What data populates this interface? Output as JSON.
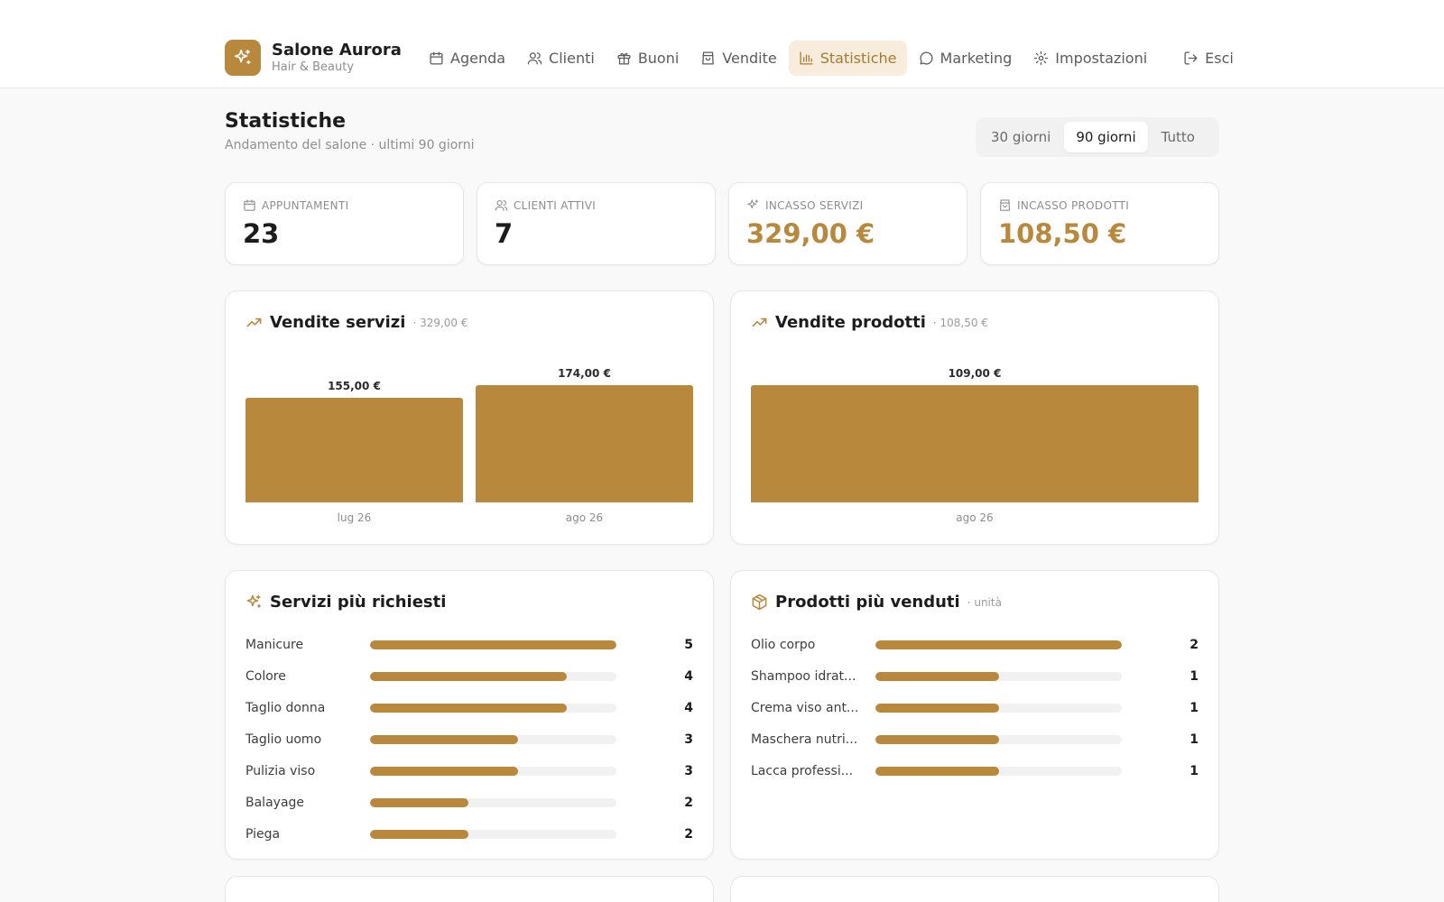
{
  "brand": {
    "name": "Salone Aurora",
    "subtitle": "Hair & Beauty",
    "accent": "#b8883c"
  },
  "nav": [
    {
      "label": "Agenda",
      "icon": "calendar-icon",
      "active": false
    },
    {
      "label": "Clienti",
      "icon": "users-icon",
      "active": false
    },
    {
      "label": "Buoni",
      "icon": "gift-icon",
      "active": false
    },
    {
      "label": "Vendite",
      "icon": "shopping-bag-icon",
      "active": false
    },
    {
      "label": "Statistiche",
      "icon": "bar-chart-icon",
      "active": true
    },
    {
      "label": "Marketing",
      "icon": "message-circle-icon",
      "active": false
    },
    {
      "label": "Impostazioni",
      "icon": "gear-icon",
      "active": false
    },
    {
      "label": "Esci",
      "icon": "logout-icon",
      "active": false
    }
  ],
  "page": {
    "title": "Statistiche",
    "subtitle": "Andamento del salone · ultimi 90 giorni"
  },
  "range": {
    "options": [
      "30 giorni",
      "90 giorni",
      "Tutto"
    ],
    "selected": "90 giorni"
  },
  "kpis": [
    {
      "label": "APPUNTAMENTI",
      "value": "23",
      "icon": "calendar-icon"
    },
    {
      "label": "CLIENTI ATTIVI",
      "value": "7",
      "icon": "users-icon"
    },
    {
      "label": "INCASSO SERVIZI",
      "value": "329,00 €",
      "icon": "sparkles-icon"
    },
    {
      "label": "INCASSO PRODOTTI",
      "value": "108,50 €",
      "icon": "shopping-bag-icon"
    }
  ],
  "services_sales": {
    "title": "Vendite servizi",
    "note": "· 329,00 €",
    "icon": "trending-up-icon",
    "chart_data": {
      "type": "bar",
      "categories": [
        "lug 26",
        "ago 26"
      ],
      "values": [
        155,
        174
      ],
      "value_labels": [
        "155,00 €",
        "174,00 €"
      ]
    }
  },
  "products_sales": {
    "title": "Vendite prodotti",
    "note": "· 108,50 €",
    "icon": "trending-up-icon",
    "chart_data": {
      "type": "bar",
      "categories": [
        "ago 26"
      ],
      "values": [
        109
      ],
      "value_labels": [
        "109,00 €"
      ]
    }
  },
  "top_services": {
    "title": "Servizi più richiesti",
    "icon": "sparkles-icon",
    "max": 5,
    "items": [
      {
        "name": "Manicure",
        "count": 5
      },
      {
        "name": "Colore",
        "count": 4
      },
      {
        "name": "Taglio donna",
        "count": 4
      },
      {
        "name": "Taglio uomo",
        "count": 3
      },
      {
        "name": "Pulizia viso",
        "count": 3
      },
      {
        "name": "Balayage",
        "count": 2
      },
      {
        "name": "Piega",
        "count": 2
      }
    ]
  },
  "top_products": {
    "title": "Prodotti più venduti",
    "note": "· unità",
    "icon": "package-icon",
    "max": 2,
    "items": [
      {
        "name": "Olio corpo",
        "count": 2
      },
      {
        "name": "Shampoo idrat...",
        "count": 1
      },
      {
        "name": "Crema viso ant...",
        "count": 1
      },
      {
        "name": "Maschera nutri...",
        "count": 1
      },
      {
        "name": "Lacca professi...",
        "count": 1
      }
    ]
  }
}
